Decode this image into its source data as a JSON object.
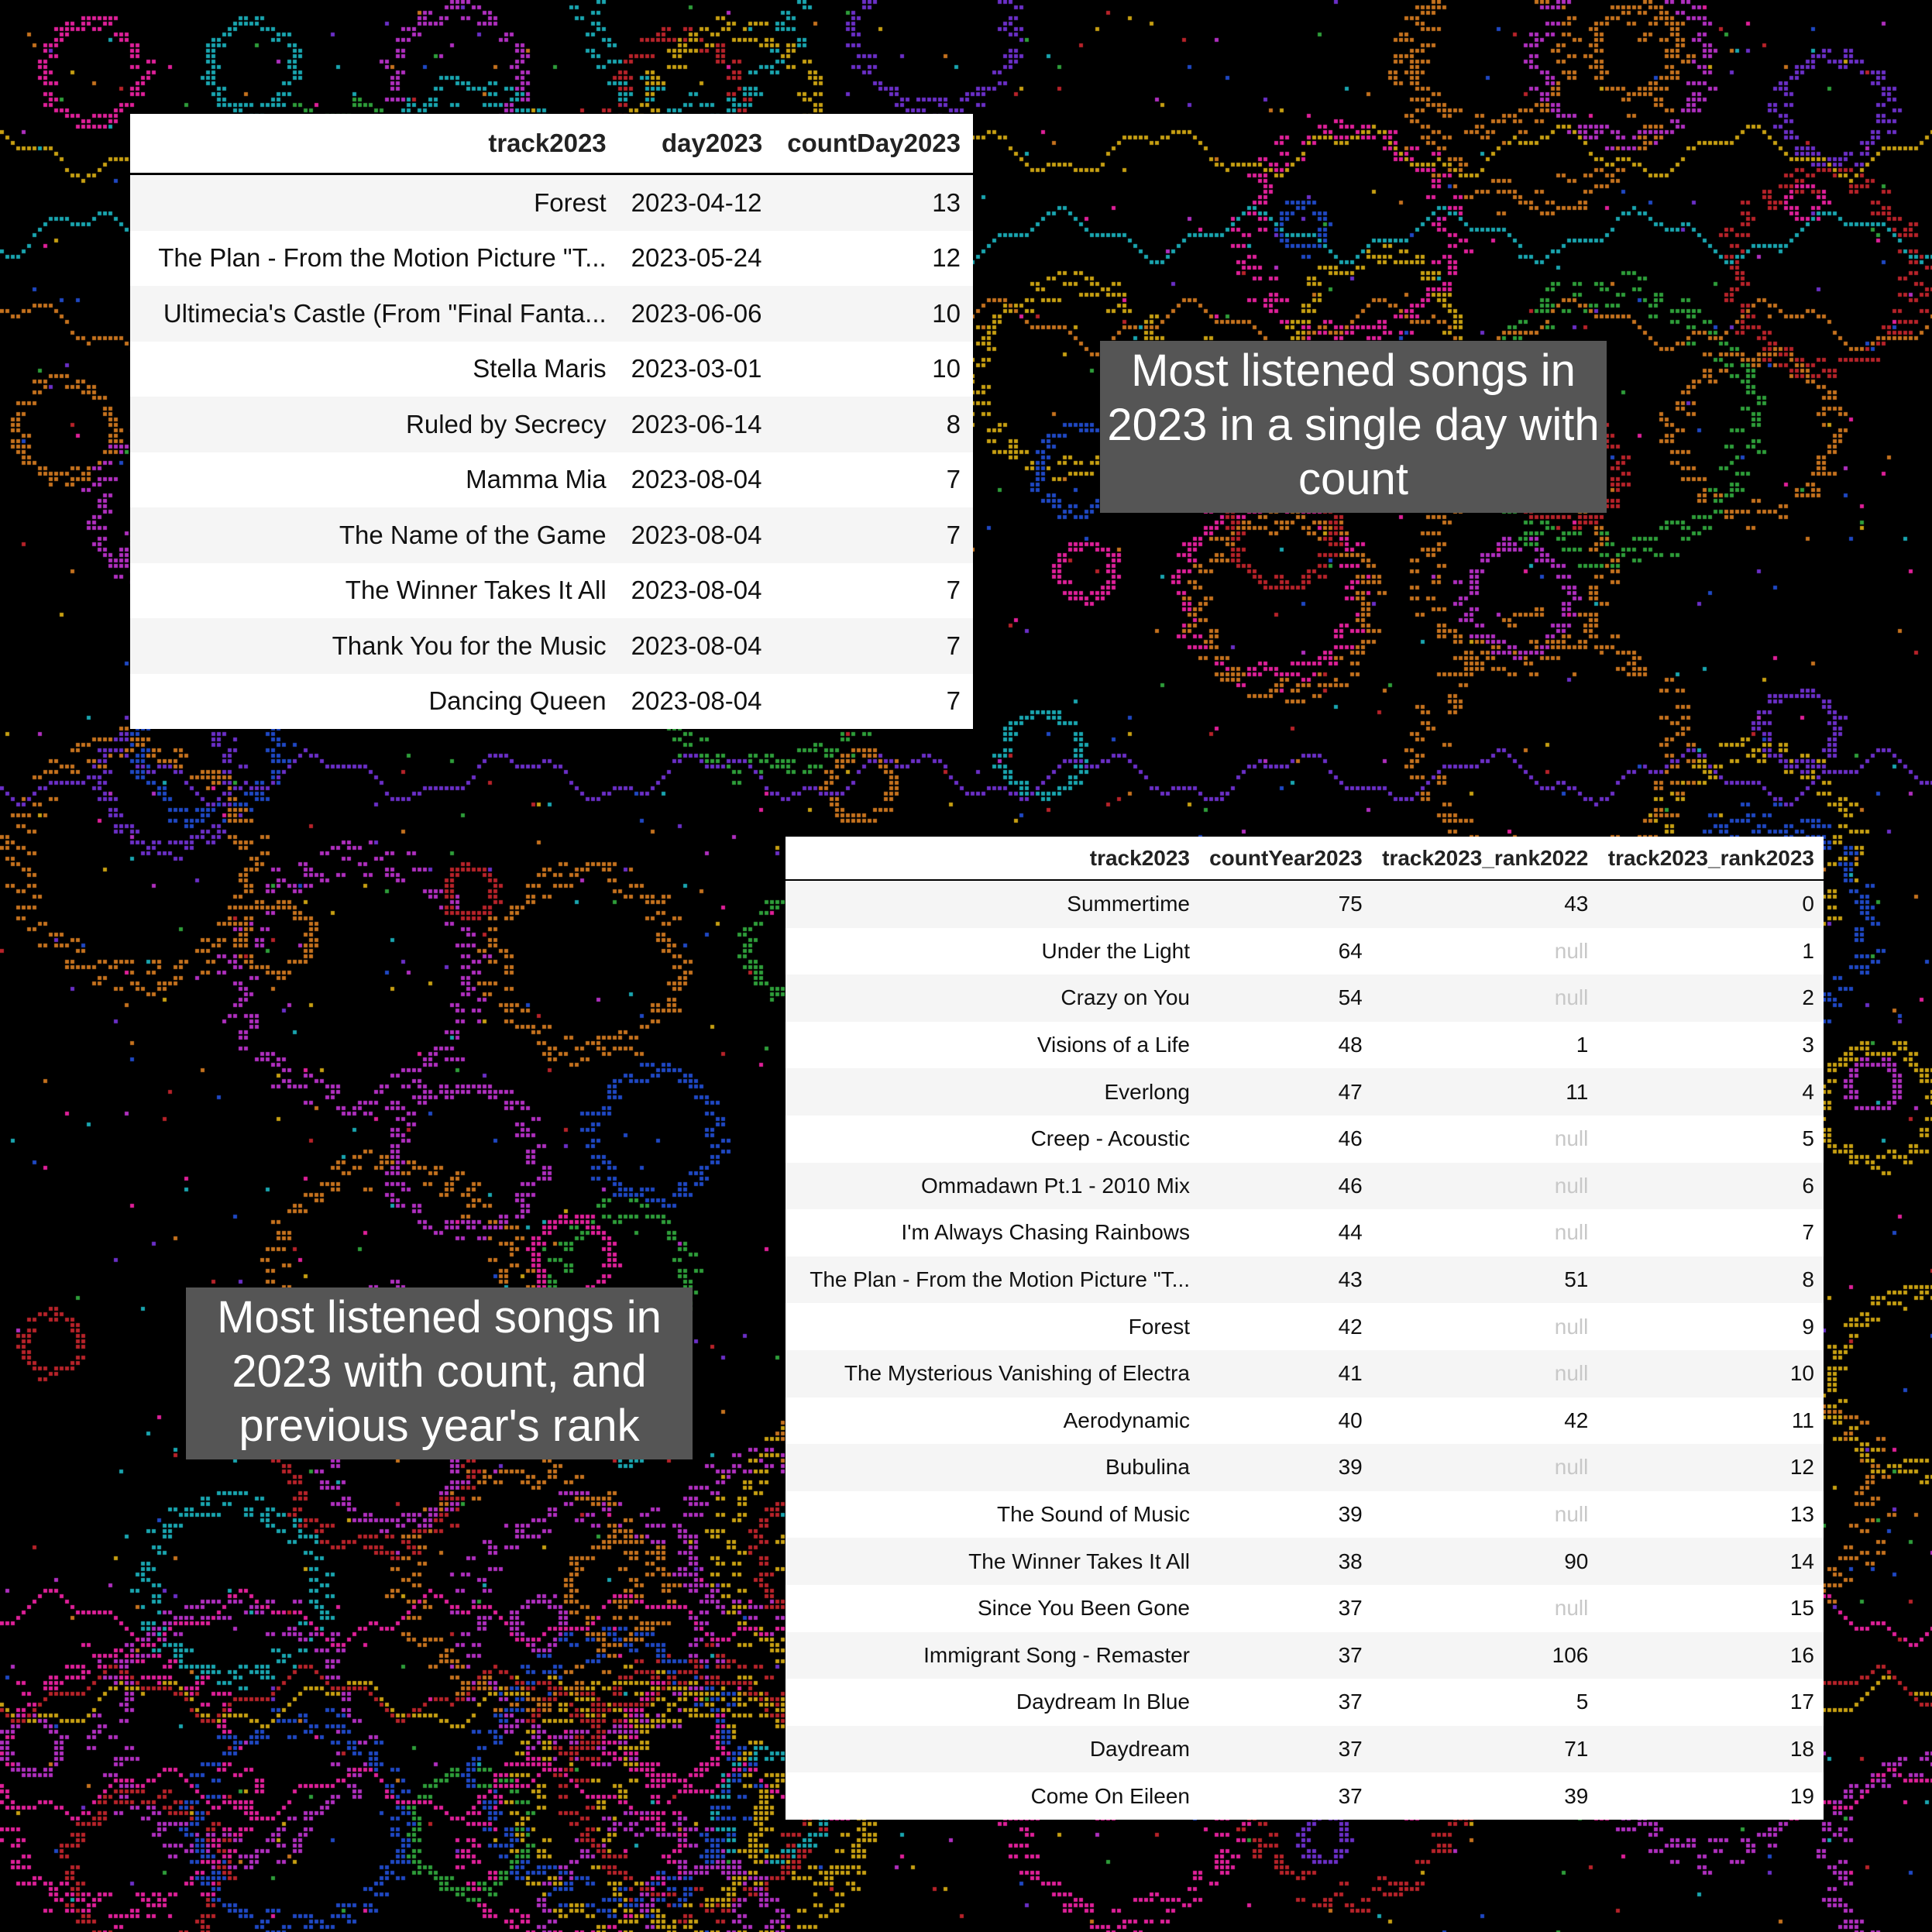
{
  "table_day": {
    "columns": [
      "track2023",
      "day2023",
      "countDay2023"
    ],
    "rows": [
      [
        "Forest",
        "2023-04-12",
        "13"
      ],
      [
        "The Plan - From the Motion Picture \"T...",
        "2023-05-24",
        "12"
      ],
      [
        "Ultimecia's Castle (From \"Final Fanta...",
        "2023-06-06",
        "10"
      ],
      [
        "Stella Maris",
        "2023-03-01",
        "10"
      ],
      [
        "Ruled by Secrecy",
        "2023-06-14",
        "8"
      ],
      [
        "Mamma Mia",
        "2023-08-04",
        "7"
      ],
      [
        "The Name of the Game",
        "2023-08-04",
        "7"
      ],
      [
        "The Winner Takes It All",
        "2023-08-04",
        "7"
      ],
      [
        "Thank You for the Music",
        "2023-08-04",
        "7"
      ],
      [
        "Dancing Queen",
        "2023-08-04",
        "7"
      ]
    ]
  },
  "caption_day": "Most listened songs in 2023 in a single day with count",
  "table_year": {
    "columns": [
      "track2023",
      "countYear2023",
      "track2023_rank2022",
      "track2023_rank2023"
    ],
    "rows": [
      [
        "Summertime",
        "75",
        "43",
        "0"
      ],
      [
        "Under the Light",
        "64",
        "null",
        "1"
      ],
      [
        "Crazy on You",
        "54",
        "null",
        "2"
      ],
      [
        "Visions of a Life",
        "48",
        "1",
        "3"
      ],
      [
        "Everlong",
        "47",
        "11",
        "4"
      ],
      [
        "Creep - Acoustic",
        "46",
        "null",
        "5"
      ],
      [
        "Ommadawn Pt.1 - 2010 Mix",
        "46",
        "null",
        "6"
      ],
      [
        "I'm Always Chasing Rainbows",
        "44",
        "null",
        "7"
      ],
      [
        "The Plan - From the Motion Picture \"T...",
        "43",
        "51",
        "8"
      ],
      [
        "Forest",
        "42",
        "null",
        "9"
      ],
      [
        "The Mysterious Vanishing of Electra",
        "41",
        "null",
        "10"
      ],
      [
        "Aerodynamic",
        "40",
        "42",
        "11"
      ],
      [
        "Bubulina",
        "39",
        "null",
        "12"
      ],
      [
        "The Sound of Music",
        "39",
        "null",
        "13"
      ],
      [
        "The Winner Takes It All",
        "38",
        "90",
        "14"
      ],
      [
        "Since You Been Gone",
        "37",
        "null",
        "15"
      ],
      [
        "Immigrant Song - Remaster",
        "37",
        "106",
        "16"
      ],
      [
        "Daydream In Blue",
        "37",
        "5",
        "17"
      ],
      [
        "Daydream",
        "37",
        "71",
        "18"
      ],
      [
        "Come On Eileen",
        "37",
        "39",
        "19"
      ]
    ]
  },
  "caption_year": "Most listened songs in 2023 with count, and previous year's rank",
  "background": {
    "base_color": "#000000",
    "pattern_colors": [
      "#2e9e3a",
      "#1f48c4",
      "#b8232a",
      "#c8a012",
      "#b12fc0",
      "#6b2fc8",
      "#1aa6b0",
      "#c6721e",
      "#e0209a"
    ]
  }
}
